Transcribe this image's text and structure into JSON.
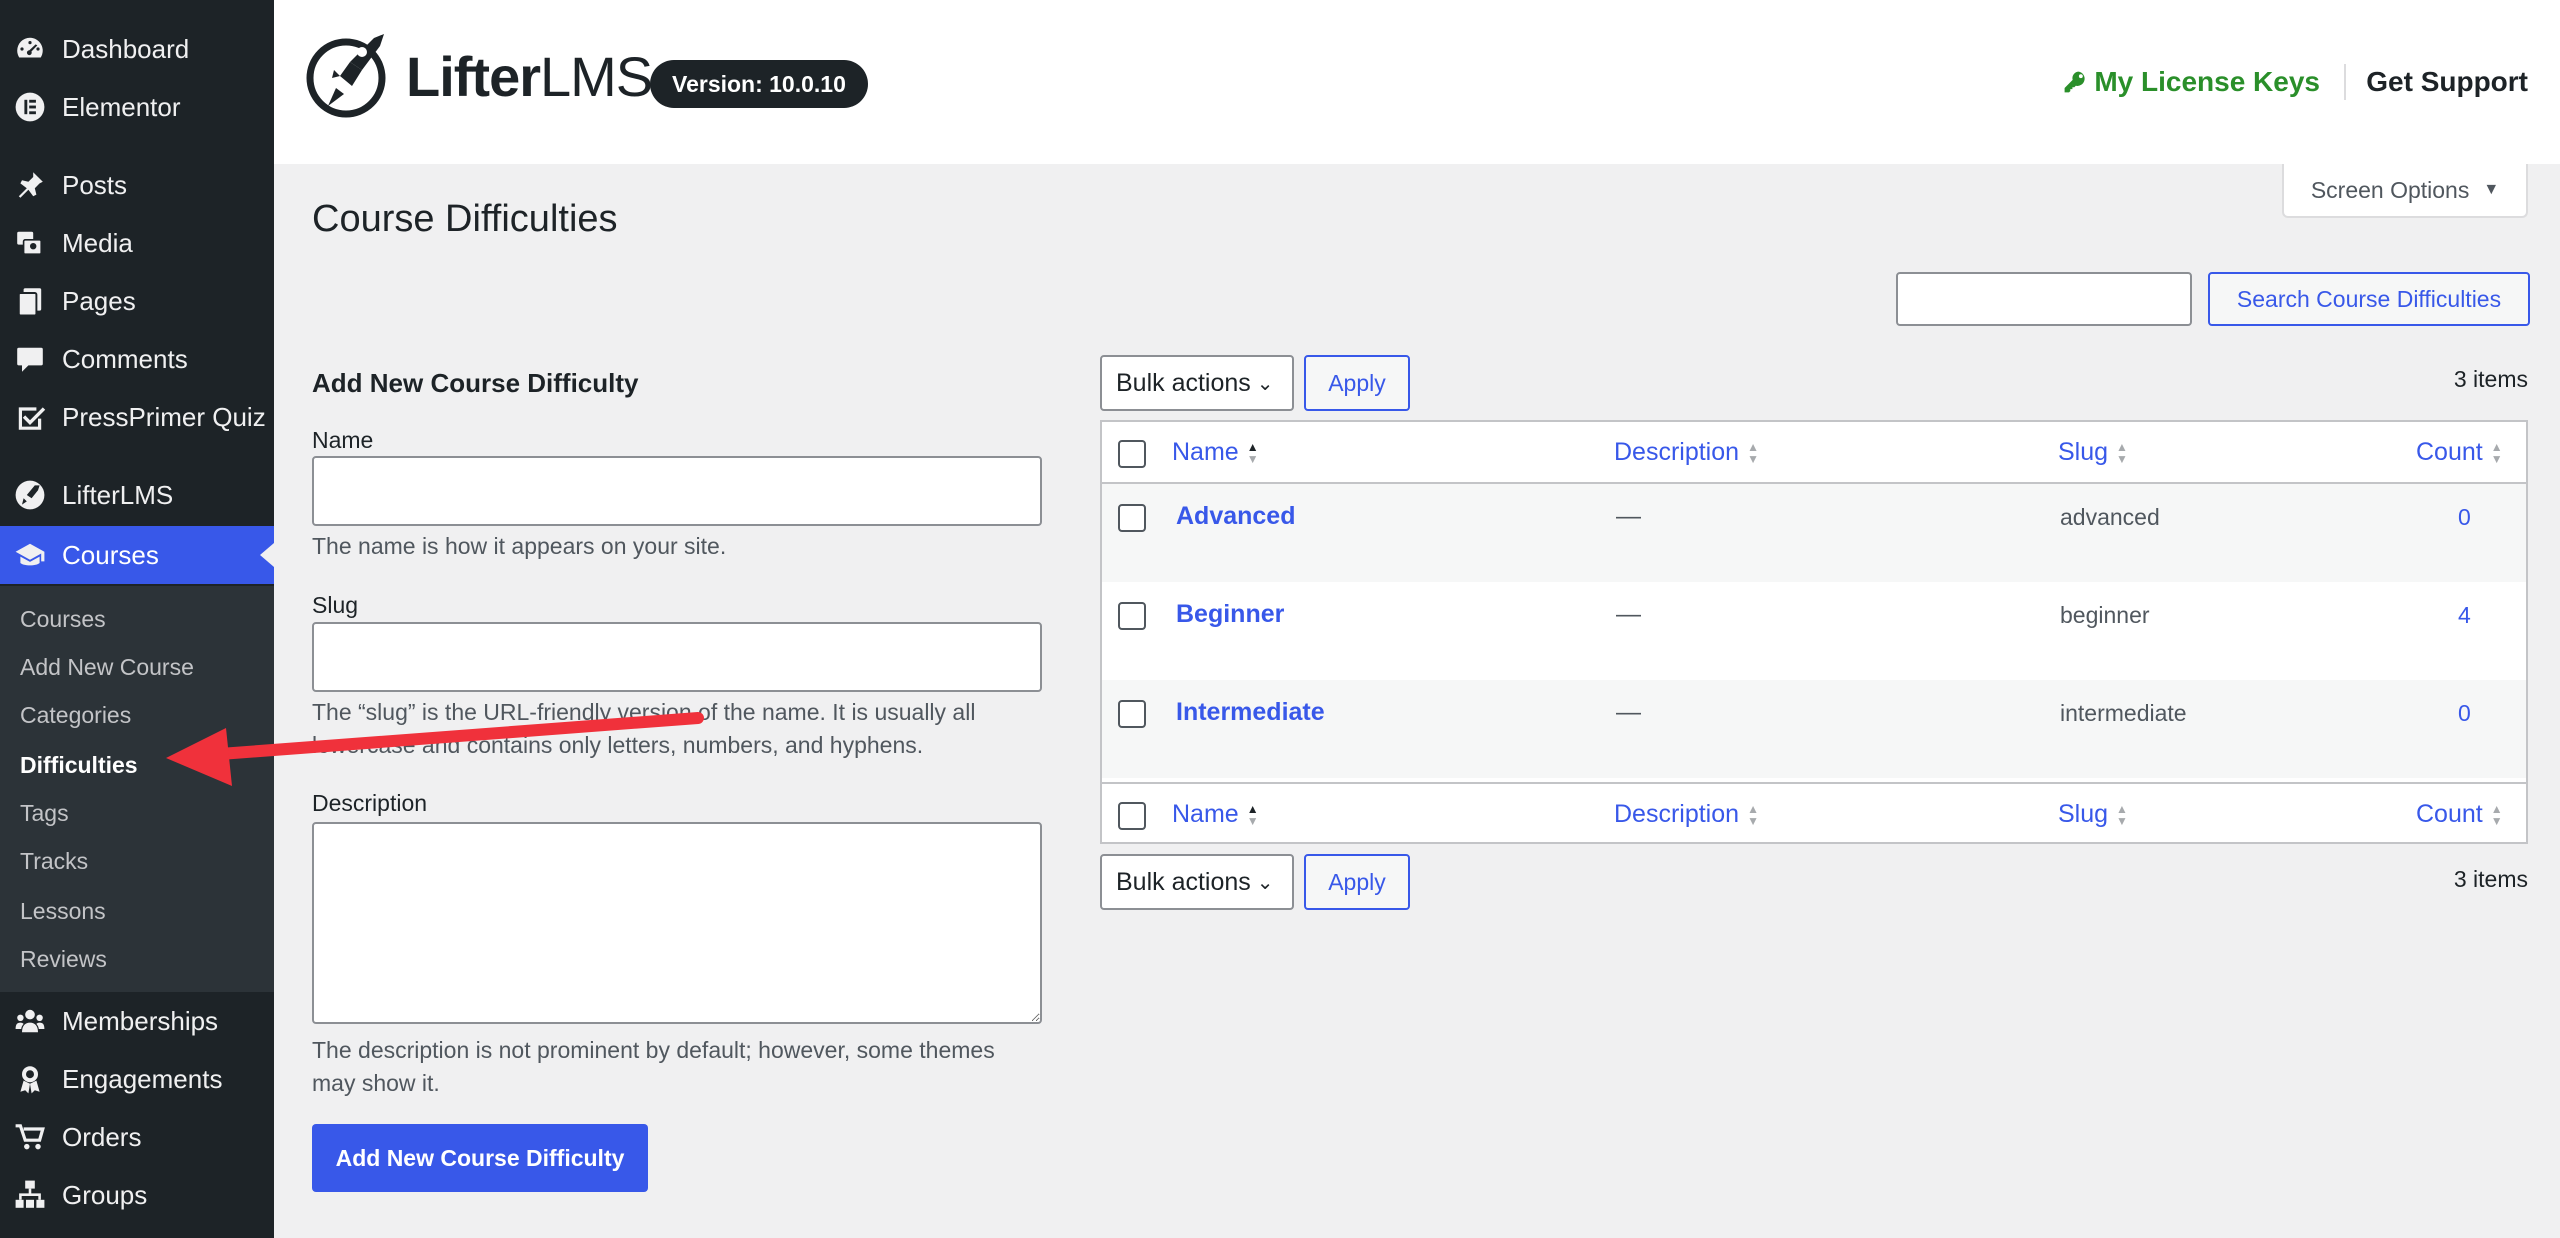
{
  "sidebar": {
    "items": [
      {
        "label": "Dashboard",
        "icon": "dashboard-icon"
      },
      {
        "label": "Elementor",
        "icon": "elementor-icon"
      },
      {
        "label": "Posts",
        "icon": "pin-icon"
      },
      {
        "label": "Media",
        "icon": "media-icon"
      },
      {
        "label": "Pages",
        "icon": "pages-icon"
      },
      {
        "label": "Comments",
        "icon": "comment-icon"
      },
      {
        "label": "PressPrimer Quiz",
        "icon": "checkbox-icon"
      },
      {
        "label": "LifterLMS",
        "icon": "rocket-icon"
      },
      {
        "label": "Courses",
        "icon": "graduation-cap-icon"
      }
    ],
    "submenu": [
      "Courses",
      "Add New Course",
      "Categories",
      "Difficulties",
      "Tags",
      "Tracks",
      "Lessons",
      "Reviews"
    ],
    "bottom_items": [
      {
        "label": "Memberships",
        "icon": "group-icon"
      },
      {
        "label": "Engagements",
        "icon": "award-icon"
      },
      {
        "label": "Orders",
        "icon": "cart-icon"
      },
      {
        "label": "Groups",
        "icon": "hierarchy-icon"
      }
    ]
  },
  "header": {
    "brand_bold": "Lifter",
    "brand_light": "LMS",
    "version": "Version: 10.0.10",
    "license_link": "My License Keys",
    "support_link": "Get Support"
  },
  "screen_options": "Screen Options",
  "page": {
    "title": "Course Difficulties",
    "search_button": "Search Course Difficulties"
  },
  "form": {
    "heading": "Add New Course Difficulty",
    "name_label": "Name",
    "name_help": "The name is how it appears on your site.",
    "slug_label": "Slug",
    "slug_help": "The “slug” is the URL-friendly version of the name. It is usually all lowercase and contains only letters, numbers, and hyphens.",
    "description_label": "Description",
    "description_help": "The description is not prominent by default; however, some themes may show it.",
    "submit_label": "Add New Course Difficulty"
  },
  "table": {
    "bulk_actions": "Bulk actions",
    "apply": "Apply",
    "items_count": "3 items",
    "columns": [
      "Name",
      "Description",
      "Slug",
      "Count"
    ],
    "rows": [
      {
        "name": "Advanced",
        "description": "—",
        "slug": "advanced",
        "count": "0"
      },
      {
        "name": "Beginner",
        "description": "—",
        "slug": "beginner",
        "count": "4"
      },
      {
        "name": "Intermediate",
        "description": "—",
        "slug": "intermediate",
        "count": "0"
      }
    ]
  },
  "colors": {
    "accent": "#3858e9",
    "sidebar_bg": "#1d2327",
    "license_green": "#2a8f2a",
    "annotation_arrow": "#f0313b"
  }
}
